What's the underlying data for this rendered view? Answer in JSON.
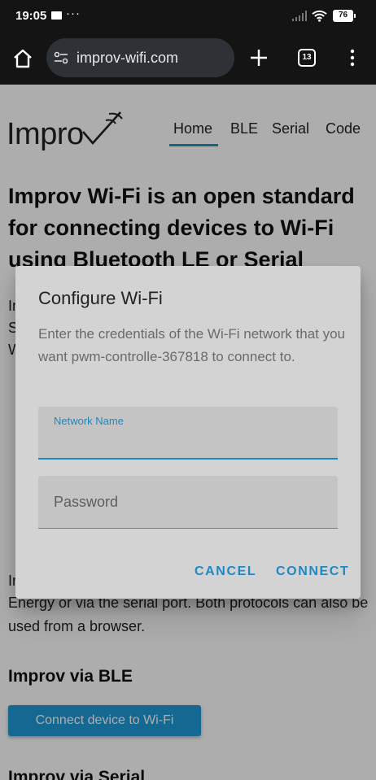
{
  "status_bar": {
    "time": "19:05",
    "dots": "···",
    "battery": "76"
  },
  "browser": {
    "url": "improv-wifi.com",
    "tab_count": "13"
  },
  "site": {
    "logo_text": "Impro",
    "nav": {
      "home": "Home",
      "ble": "BLE",
      "serial": "Serial",
      "code": "Code"
    },
    "hero_title": "Improv Wi-Fi is an open standard for connecting devices to Wi-Fi using Bluetooth LE or Serial",
    "frag_line1": "In",
    "frag_line2": "S",
    "frag_line3": "W",
    "frag_line4": "Ir",
    "body_text": "Energy or via the serial port. Both protocols can also be used from a browser.",
    "ble_heading": "Improv via BLE",
    "ble_button": "Connect device to Wi-Fi",
    "serial_heading": "Improv via Serial"
  },
  "dialog": {
    "title": "Configure Wi-Fi",
    "description": "Enter the credentials of the Wi-Fi network that you want pwm-controlle-367818 to connect to.",
    "network_label": "Network Name",
    "network_value": "",
    "password_label": "Password",
    "cancel": "CANCEL",
    "connect": "CONNECT"
  },
  "colors": {
    "accent": "#1e88c4",
    "page_button": "#1e9ad6",
    "dialog_bg": "#d3d3d3",
    "browser_bar": "#141414"
  }
}
